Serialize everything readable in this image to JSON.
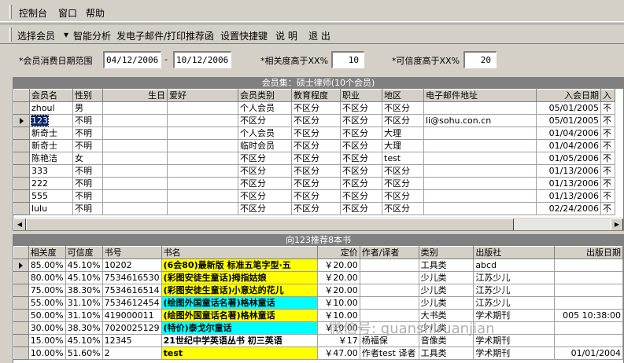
{
  "menu": [
    "控制台",
    "窗口",
    "帮助"
  ],
  "toolbar": [
    "选择会员",
    "智能分析",
    "发电子邮件/打印推荐函",
    "设置快捷键",
    "说 明",
    "退 出"
  ],
  "filter": {
    "date_label": "*会员消费日期范围",
    "date_from": "04/12/2006",
    "date_sep": "-",
    "date_to": "10/12/2006",
    "relevance_label": "*相关度高于XX%",
    "relevance_value": "10",
    "credibility_label": "*可信度高于XX%",
    "credibility_value": "20"
  },
  "members": {
    "caption": "会员集：硕士律师(10个会员)",
    "columns": [
      "会员名",
      "性别",
      "生日",
      "爱好",
      "会员类别",
      "教育程度",
      "职业",
      "地区",
      "电子邮件地址",
      "入会日期",
      "入"
    ],
    "rows": [
      [
        "zhoul",
        "男",
        "",
        "",
        "个人会员",
        "不区分",
        "不区分",
        "不区分",
        "",
        "05/01/2005",
        "不"
      ],
      [
        "123",
        "不明",
        "",
        "",
        "不区分",
        "不区分",
        "不区分",
        "不区分",
        "li@sohu.con.cn",
        "05/01/2005",
        "不"
      ],
      [
        "新奇士",
        "不明",
        "",
        "",
        "个人会员",
        "不区分",
        "不区分",
        "大理",
        "",
        "01/04/2006",
        "不"
      ],
      [
        "新奇士",
        "不明",
        "",
        "",
        "临时会员",
        "不区分",
        "不区分",
        "大理",
        "",
        "01/04/2006",
        "不"
      ],
      [
        "陈艳洁",
        "女",
        "",
        "",
        "不区分",
        "不区分",
        "不区分",
        "test",
        "",
        "01/05/2006",
        "不"
      ],
      [
        "333",
        "不明",
        "",
        "",
        "不区分",
        "不区分",
        "不区分",
        "不区分",
        "",
        "01/13/2006",
        "不"
      ],
      [
        "222",
        "不明",
        "",
        "",
        "不区分",
        "不区分",
        "不区分",
        "不区分",
        "",
        "01/13/2006",
        "不"
      ],
      [
        "555",
        "不明",
        "",
        "",
        "不区分",
        "不区分",
        "不区分",
        "不区分",
        "",
        "01/13/2006",
        "不"
      ],
      [
        "lulu",
        "不明",
        "",
        "",
        "不区分",
        "不区分",
        "不区分",
        "不区分",
        "",
        "02/24/2006",
        "不"
      ]
    ]
  },
  "books": {
    "caption": "向123推荐8本书",
    "columns": [
      "相关度",
      "可信度",
      "书号",
      "书名",
      "定价",
      "作者/译者",
      "类别",
      "出版社",
      "出版日期"
    ],
    "rows": [
      [
        "85.00%",
        "45.10%",
        "10202",
        "(6会80)最新版 标准五笔字型·五",
        "￥20.00",
        "",
        "工具类",
        "abcd",
        ""
      ],
      [
        "80.00%",
        "45.10%",
        "7534616530",
        "(彩图安徒生童话)拇指姑娘",
        "￥20.00",
        "",
        "少儿类",
        "江苏少儿",
        ""
      ],
      [
        "75.00%",
        "38.30%",
        "7534616514",
        "(彩图安徒生童话)小意达的花儿",
        "￥20.00",
        "",
        "少儿类",
        "江苏少儿",
        ""
      ],
      [
        "55.00%",
        "31.10%",
        "7534612454",
        "(绘图外国童话名著)格林童话",
        "￥10.00",
        "",
        "少儿类",
        "江苏少儿",
        ""
      ],
      [
        "50.00%",
        "31.10%",
        "419000011",
        "(绘图外国童话名著)格林童话",
        "￥10.00",
        "",
        "大书类",
        "学术期刊",
        "005 10:38:00"
      ],
      [
        "30.00%",
        "38.30%",
        "7020025129",
        "(特价)泰戈尔童话",
        "￥10.00",
        "",
        "少儿类",
        "",
        ""
      ],
      [
        "15.00%",
        "45.10%",
        "12345",
        "21世纪中学英语丛书 初三英语",
        "￥17",
        "杨福保",
        "音像类",
        "学术期刊",
        ""
      ],
      [
        "10.00%",
        "51.60%",
        "2",
        "test",
        "￥47.00",
        "作者test 译者",
        "工具类",
        "学术期刊",
        "01/01/2004"
      ]
    ],
    "highlight": [
      "yellow",
      "yellow",
      "yellow",
      "cyan",
      "yellow",
      "cyan",
      "none",
      "yellow"
    ]
  },
  "watermark": "微信号: quanshiruanjian"
}
